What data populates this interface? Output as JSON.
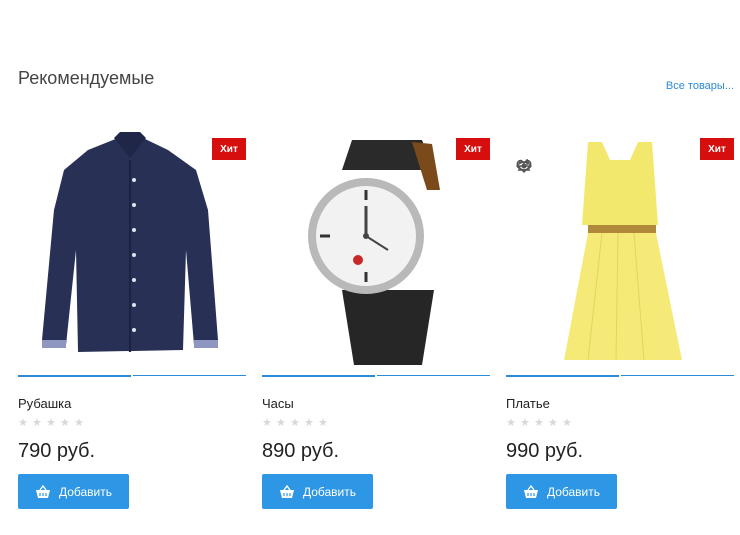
{
  "section": {
    "title": "Рекомендуемые",
    "all_link": "Все товары..."
  },
  "products": [
    {
      "name": "Рубашка",
      "price": "790 руб.",
      "badge": "Хит",
      "button": "Добавить",
      "rating": 0
    },
    {
      "name": "Часы",
      "price": "890 руб.",
      "badge": "Хит",
      "button": "Добавить",
      "rating": 0
    },
    {
      "name": "Платье",
      "price": "990 руб.",
      "badge": "Хит",
      "button": "Добавить",
      "rating": 0
    }
  ],
  "icons": {
    "compare": "compare-icon",
    "wishlist": "heart-icon",
    "quick_view": "eye-icon",
    "basket": "basket-icon",
    "star": "star-icon"
  },
  "colors": {
    "accent": "#2d97e6",
    "badge": "#d70e0e",
    "star_empty": "#d8d8d8"
  }
}
